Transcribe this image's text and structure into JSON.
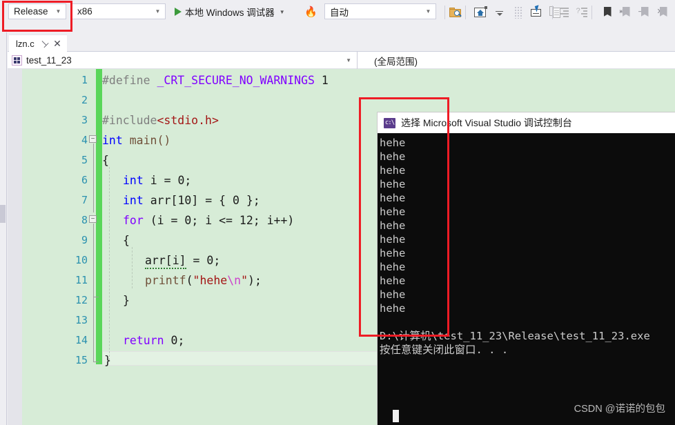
{
  "toolbar": {
    "config_value": "Release",
    "platform_value": "x86",
    "run_label": "本地 Windows 调试器",
    "auto_value": "自动",
    "caret_glyph": "▼",
    "icons": [
      "folder-search-icon",
      "home-window-icon",
      "drop-line-icon",
      "dotted-grip-icon",
      "cursor-window-icon",
      "copy-window-icon",
      "indent-icon",
      "question-indent-icon",
      "bookmark-icon",
      "prev-bookmark-icon",
      "next-bookmark-icon",
      "clear-bookmarks-icon"
    ]
  },
  "tabs": {
    "active": "lzn.c",
    "pin_glyph": "⊣",
    "close_glyph": "✕"
  },
  "navbar": {
    "type_value": "test_11_23",
    "member_value": "(全局范围)",
    "caret_glyph": "▼"
  },
  "editor": {
    "line_numbers": [
      1,
      2,
      3,
      4,
      5,
      6,
      7,
      8,
      9,
      10,
      11,
      12,
      13,
      14,
      15
    ],
    "lines": [
      {
        "n": 1,
        "text": "#define _CRT_SECURE_NO_WARNINGS 1"
      },
      {
        "n": 2,
        "text": ""
      },
      {
        "n": 3,
        "text": "#include<stdio.h>"
      },
      {
        "n": 4,
        "text": "int main()"
      },
      {
        "n": 5,
        "text": "{"
      },
      {
        "n": 6,
        "text": "    int i = 0;"
      },
      {
        "n": 7,
        "text": "    int arr[10] = { 0 };"
      },
      {
        "n": 8,
        "text": "    for (i = 0; i <= 12; i++)"
      },
      {
        "n": 9,
        "text": "    {"
      },
      {
        "n": 10,
        "text": "        arr[i] = 0;"
      },
      {
        "n": 11,
        "text": "        printf(\"hehe\\n\");"
      },
      {
        "n": 12,
        "text": "    }"
      },
      {
        "n": 13,
        "text": ""
      },
      {
        "n": 14,
        "text": "    return 0;"
      },
      {
        "n": 15,
        "text": "}"
      }
    ],
    "tok": {
      "define": "#define",
      "crt_macro": "_CRT_SECURE_NO_WARNINGS",
      "one": "1",
      "include": "#include",
      "stdio": "<stdio.h>",
      "int": "int",
      "main": " main()",
      "brace_open": "{",
      "brace_close": "}",
      "decl_i": " i = 0;",
      "decl_arr": " arr[10] = { 0 };",
      "for": "for",
      "for_cond": " (i = 0; i <= 12; i++)",
      "arr_i": "arr[i]",
      "assign_zero": " = 0;",
      "printf": "printf",
      "paren_open": "(",
      "string": "\"hehe",
      "escape": "\\n",
      "string_end": "\"",
      "paren_close": ");",
      "return": "return",
      "zero_semi": " 0;",
      "fold_glyph": "−"
    }
  },
  "console": {
    "title": "选择 Microsoft Visual Studio 调试控制台",
    "icon_text": "c:\\",
    "output_lines": [
      "hehe",
      "hehe",
      "hehe",
      "hehe",
      "hehe",
      "hehe",
      "hehe",
      "hehe",
      "hehe",
      "hehe",
      "hehe",
      "hehe",
      "hehe"
    ],
    "exe_path": "D:\\计算机\\test_11_23\\Release\\test_11_23.exe",
    "close_prompt": "按任意键关闭此窗口. . ."
  },
  "watermark": "CSDN @诺诺的包包",
  "colors": {
    "toolbar_bg": "#eeeef2",
    "editor_bg": "#d7ecd7",
    "change_bar": "#59d659",
    "annotation_red": "#ee1c25",
    "console_bg": "#0c0c0c",
    "linenum": "#2b91af",
    "keyword_purple": "#8000ff",
    "keyword_blue": "#0000ff",
    "string_red": "#a31515"
  }
}
